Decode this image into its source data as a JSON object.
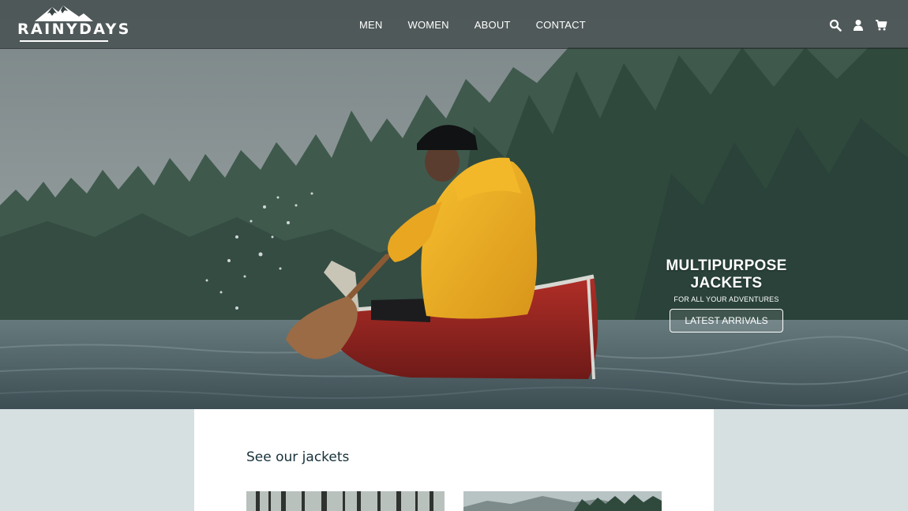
{
  "brand": {
    "name": "RAINYDAYS"
  },
  "nav": {
    "links": [
      "MEN",
      "WOMEN",
      "ABOUT",
      "CONTACT"
    ],
    "icons": [
      "search-icon",
      "user-icon",
      "cart-icon"
    ]
  },
  "hero": {
    "title": "MULTIPURPOSE JACKETS",
    "subtitle": "FOR ALL YOUR ADVENTURES",
    "button": "LATEST ARRIVALS"
  },
  "main": {
    "section_title": "See our jackets",
    "cards": [
      {
        "image": "forest-trees-photo"
      },
      {
        "image": "lake-mountains-photo"
      }
    ]
  },
  "colors": {
    "content_background": "#d7e0e0",
    "heading_text": "#16313a",
    "jacket_yellow": "#f0ad1d",
    "canoe_red": "#9b2420"
  }
}
